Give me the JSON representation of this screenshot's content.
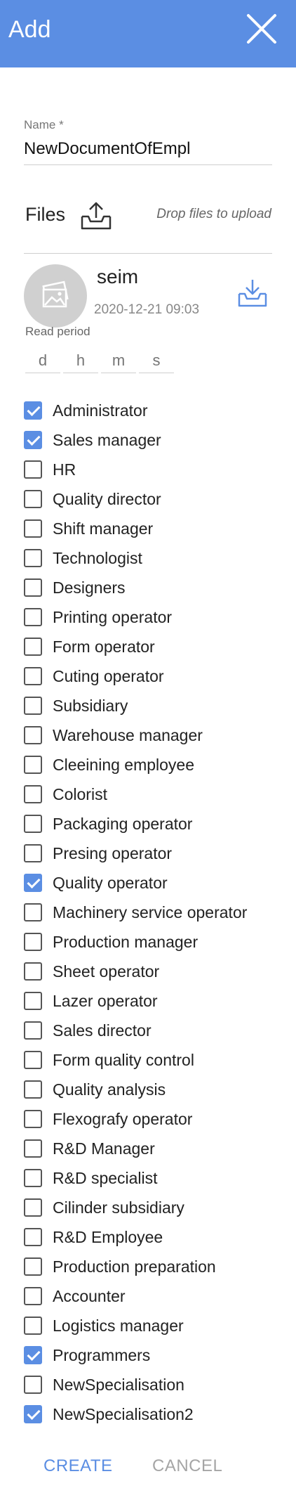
{
  "header": {
    "title": "Add",
    "close_icon": "close-icon",
    "background": "#5b8ee3"
  },
  "name_field": {
    "label": "Name *",
    "value": "NewDocumentOfEmpl"
  },
  "files": {
    "label": "Files",
    "upload_icon": "upload-icon",
    "drop_hint": "Drop files to upload",
    "items": [
      {
        "name": "seim",
        "date": "2020-12-21 09:03",
        "thumbnail_icon": "image-placeholder-icon",
        "download_icon": "download-icon",
        "read_period": {
          "label": "Read period",
          "fields": [
            {
              "placeholder": "d",
              "value": ""
            },
            {
              "placeholder": "h",
              "value": ""
            },
            {
              "placeholder": "m",
              "value": ""
            },
            {
              "placeholder": "s",
              "value": ""
            }
          ]
        }
      }
    ]
  },
  "roles": [
    {
      "label": "Administrator",
      "checked": true
    },
    {
      "label": "Sales manager",
      "checked": true
    },
    {
      "label": "HR",
      "checked": false
    },
    {
      "label": "Quality director",
      "checked": false
    },
    {
      "label": "Shift manager",
      "checked": false
    },
    {
      "label": "Technologist",
      "checked": false
    },
    {
      "label": "Designers",
      "checked": false
    },
    {
      "label": "Printing operator",
      "checked": false
    },
    {
      "label": "Form operator",
      "checked": false
    },
    {
      "label": "Cuting operator",
      "checked": false
    },
    {
      "label": "Subsidiary",
      "checked": false
    },
    {
      "label": "Warehouse manager",
      "checked": false
    },
    {
      "label": "Cleeining employee",
      "checked": false
    },
    {
      "label": "Colorist",
      "checked": false
    },
    {
      "label": "Packaging operator",
      "checked": false
    },
    {
      "label": "Presing operator",
      "checked": false
    },
    {
      "label": "Quality operator",
      "checked": true
    },
    {
      "label": "Machinery service operator",
      "checked": false
    },
    {
      "label": "Production manager",
      "checked": false
    },
    {
      "label": "Sheet operator",
      "checked": false
    },
    {
      "label": "Lazer operator",
      "checked": false
    },
    {
      "label": "Sales director",
      "checked": false
    },
    {
      "label": "Form quality control",
      "checked": false
    },
    {
      "label": "Quality analysis",
      "checked": false
    },
    {
      "label": "Flexografy operator",
      "checked": false
    },
    {
      "label": "R&D Manager",
      "checked": false
    },
    {
      "label": "R&D specialist",
      "checked": false
    },
    {
      "label": "Cilinder subsidiary",
      "checked": false
    },
    {
      "label": "R&D Employee",
      "checked": false
    },
    {
      "label": "Production preparation",
      "checked": false
    },
    {
      "label": "Accounter",
      "checked": false
    },
    {
      "label": "Logistics manager",
      "checked": false
    },
    {
      "label": "Programmers",
      "checked": true
    },
    {
      "label": "NewSpecialisation",
      "checked": false
    },
    {
      "label": "NewSpecialisation2",
      "checked": true
    }
  ],
  "actions": {
    "create_label": "CREATE",
    "cancel_label": "CANCEL"
  },
  "colors": {
    "accent": "#5b8ee3",
    "cancel_text": "#a5a5a5",
    "avatar_bg": "#d0d0d0"
  }
}
